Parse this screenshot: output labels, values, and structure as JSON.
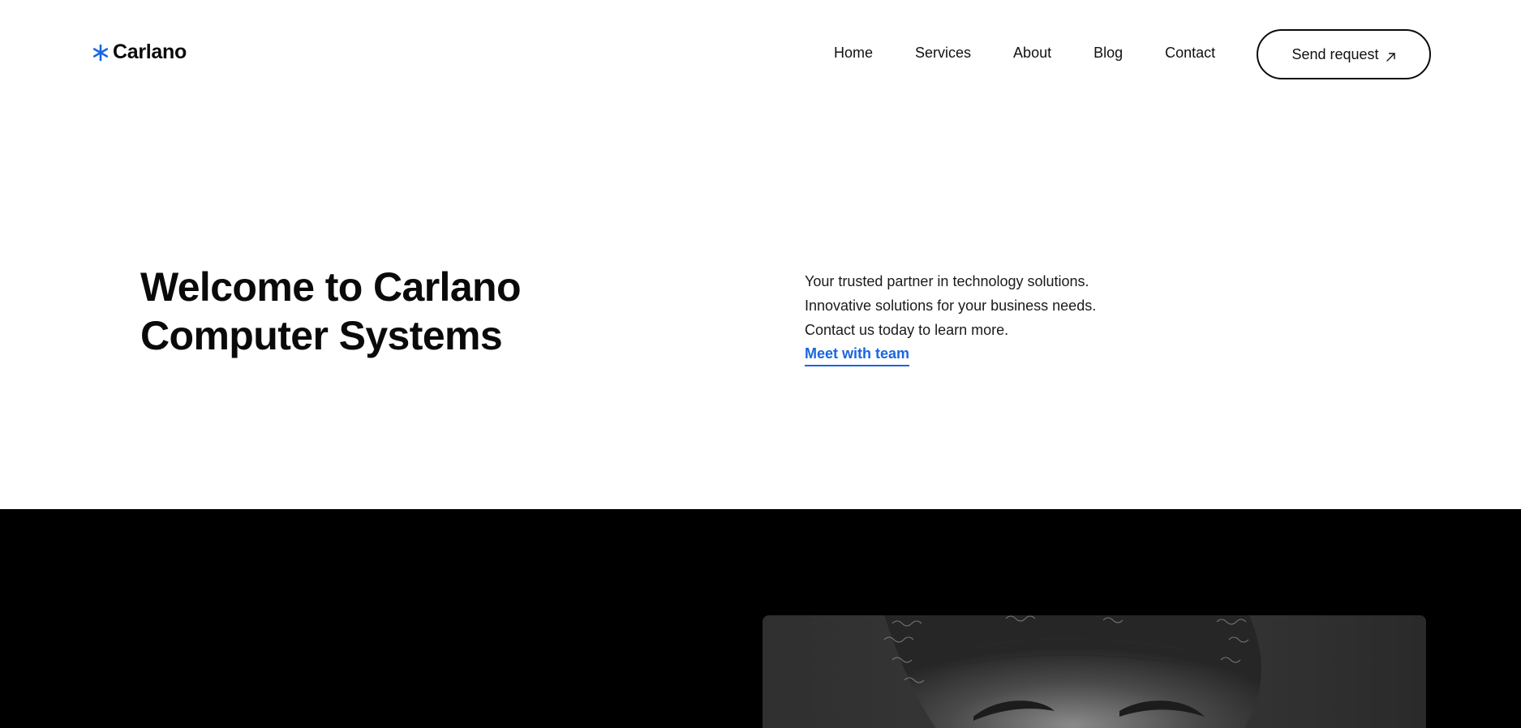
{
  "header": {
    "logo_text": "Carlano",
    "nav": [
      "Home",
      "Services",
      "About",
      "Blog",
      "Contact"
    ],
    "cta_label": "Send request"
  },
  "hero": {
    "title_line1": "Welcome to Carlano",
    "title_line2": "Computer Systems",
    "lines": [
      "Your trusted partner in technology solutions.",
      "Innovative solutions for your business needs.",
      "Contact us today to learn more."
    ],
    "link_label": "Meet with team"
  },
  "colors": {
    "accent": "#1a66e0",
    "dark_section": "#000000",
    "text": "#111111"
  },
  "icons": {
    "logo": "asterisk-icon",
    "cta": "arrow-up-right-icon"
  }
}
